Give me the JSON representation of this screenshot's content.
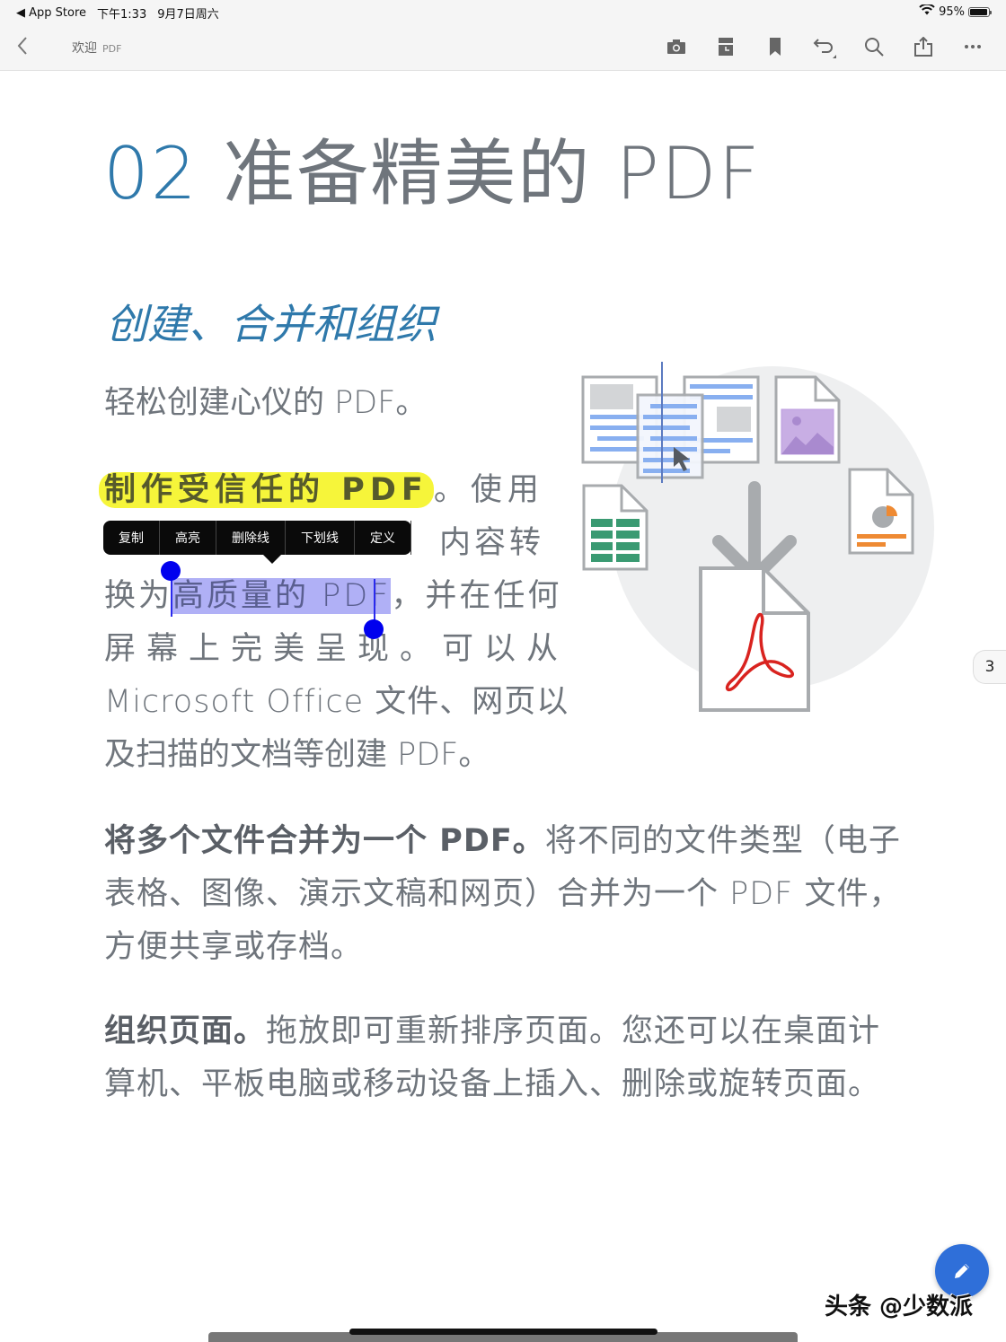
{
  "status_bar": {
    "back_app": "◀ App Store",
    "time": "下午1:33",
    "date": "9月7日周六",
    "battery_percent": "95%",
    "battery_level": 0.95,
    "wifi_icon": "wifi-icon"
  },
  "toolbar": {
    "back_icon": "chevron-left-icon",
    "title": "欢迎",
    "subtitle": "PDF",
    "tools": [
      {
        "name": "camera",
        "icon": "camera-icon"
      },
      {
        "name": "page-thumbnails",
        "icon": "pages-icon"
      },
      {
        "name": "bookmark",
        "icon": "bookmark-icon"
      },
      {
        "name": "undo",
        "icon": "undo-icon"
      },
      {
        "name": "search",
        "icon": "search-icon"
      },
      {
        "name": "share",
        "icon": "share-icon"
      },
      {
        "name": "more",
        "icon": "more-icon"
      }
    ]
  },
  "document": {
    "heading_number": "02",
    "heading_text": " 准备精美的 PDF",
    "subheading": "创建、合并和组织",
    "intro": "轻松创建心仪的 PDF。",
    "para1": {
      "highlight": "制作受信任的 PDF",
      "after_highlight": "。使用",
      "line2_tail": "内容转",
      "before_sel": "换为",
      "selected": "高质量的 PDF",
      "after_sel": "，并在任何",
      "line4": "屏幕上完美呈现。可以从",
      "line5": "Microsoft Office 文件、网页以",
      "line6": "及扫描的文档等创建 PDF。"
    },
    "para2": {
      "bold": "将多个文件合并为一个 PDF。",
      "text": "将不同的文件类型（电子表格、图像、演示文稿和网页）合并为一个 PDF 文件，方便共享或存档。"
    },
    "para3": {
      "bold": "组织页面。",
      "text": "拖放即可重新排序页面。您还可以在桌面计算机、平板电脑或移动设备上插入、删除或旋转页面。"
    },
    "page_number": "3"
  },
  "context_menu": {
    "items": [
      "复制",
      "高亮",
      "删除线",
      "下划线",
      "定义"
    ]
  },
  "fab": {
    "icon": "pencil-icon"
  },
  "watermark": "头条 @少数派",
  "colors": {
    "accent_blue": "#2f79ab",
    "highlight_yellow": "#f6f53a",
    "selection": "#b0b0f6",
    "fab_blue": "#2f6fd9",
    "acrobat_red": "#d9231f"
  }
}
